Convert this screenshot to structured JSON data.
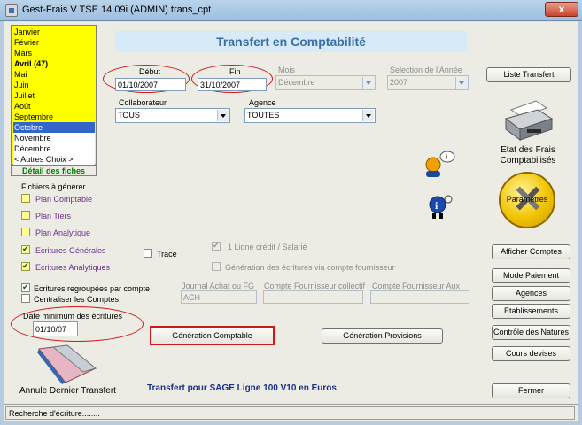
{
  "window": {
    "title": "Gest-Frais V TSE 14.09i  (ADMIN) trans_cpt",
    "close_glyph": "x"
  },
  "months": [
    {
      "label": "Janvier",
      "style": "normal"
    },
    {
      "label": "Février",
      "style": "normal"
    },
    {
      "label": "Mars",
      "style": "normal"
    },
    {
      "label": "Avril (47)",
      "style": "bold"
    },
    {
      "label": "Mai",
      "style": "normal"
    },
    {
      "label": "Juin",
      "style": "normal"
    },
    {
      "label": "Juillet",
      "style": "normal"
    },
    {
      "label": "Août",
      "style": "normal"
    },
    {
      "label": "Septembre",
      "style": "normal"
    },
    {
      "label": "Octobre",
      "style": "selected"
    },
    {
      "label": "Novembre",
      "style": "white"
    },
    {
      "label": "Décembre",
      "style": "white"
    },
    {
      "label": "< Autres Choix >",
      "style": "white"
    }
  ],
  "detail_fiches": "Détail des fiches",
  "header_title": "Transfert en Comptabilité",
  "debut": {
    "label": "Début",
    "value": "01/10/2007"
  },
  "fin": {
    "label": "Fin",
    "value": "31/10/2007"
  },
  "mois": {
    "label": "Mois",
    "value": "Décembre"
  },
  "selection_annee": {
    "label": "Selection de l'Année",
    "value": "2007"
  },
  "collaborateur": {
    "label": "Collaborateur",
    "value": "TOUS"
  },
  "agence": {
    "label": "Agence",
    "value": "TOUTES"
  },
  "fichiers_label": "Fichiers à générer",
  "fichiers": [
    {
      "label": "Plan Comptable",
      "checked": false
    },
    {
      "label": "Plan Tiers",
      "checked": false
    },
    {
      "label": "Plan Analytique",
      "checked": false
    },
    {
      "label": "Ecritures Générales",
      "checked": true
    },
    {
      "label": "Ecritures Analytiques",
      "checked": true
    }
  ],
  "trace_label": "Trace",
  "ligne_credit": "1 Ligne crédit / Salarié",
  "generation_fournisseur": "Génération des écritures via compte fournisseur",
  "ecritures_regroupees": "Ecritures regroupées par compte",
  "centraliser_comptes": "Centraliser les Comptes",
  "journal_achat": {
    "label": "Journal Achat ou FG",
    "value": "ACH"
  },
  "compte_fournisseur_collectif": {
    "label": "Compte Fournisseur collectif",
    "value": ""
  },
  "compte_fournisseur_aux": {
    "label": "Compte Fournisseur Aux",
    "value": ""
  },
  "date_min": {
    "label": "Date minimum des écritures",
    "value": "01/10/07"
  },
  "generation_comptable": "Génération Comptable",
  "generation_provisions": "Génération Provisions",
  "annule_dernier_transfert": "Annule Dernier Transfert",
  "transfert_sage": "Transfert pour SAGE Ligne 100 V10 en Euros",
  "right_buttons": {
    "liste_transfert": "Liste Transfert",
    "etat_frais": "Etat des Frais Comptabilisés",
    "parametres": "Paramètres",
    "afficher_comptes": "Afficher Comptes",
    "mode_paiement": "Mode Paiement",
    "agences": "Agences",
    "etablissements": "Etablissements",
    "controle_natures": "Contrôle des Natures",
    "cours_devises": "Cours devises",
    "fermer": "Fermer"
  },
  "status": "Recherche d'écriture........",
  "icons": [
    "printer-icon",
    "settings-tools-icon",
    "user-info-icon",
    "help-person-icon",
    "eraser-icon"
  ],
  "colors": {
    "month_bg": "#ffff00",
    "selected_month": "#3366cc",
    "title_blue": "#3b6ea8",
    "highlight_red": "#cc1a1a",
    "green_text": "#007a00"
  }
}
